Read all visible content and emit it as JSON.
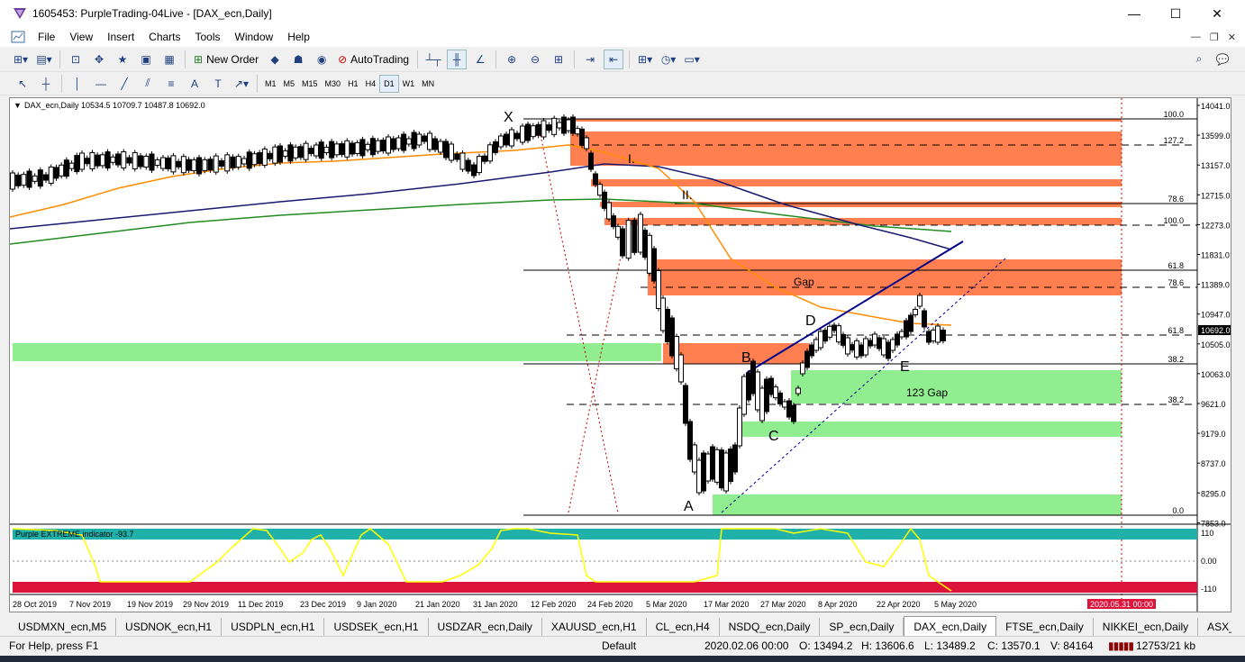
{
  "window": {
    "title": "1605453: PurpleTrading-04Live - [DAX_ecn,Daily]",
    "minimize": "—",
    "maximize": "☐",
    "close": "✕"
  },
  "menu": [
    "File",
    "View",
    "Insert",
    "Charts",
    "Tools",
    "Window",
    "Help"
  ],
  "toolbar": {
    "new_order": "New Order",
    "auto_trading": "AutoTrading"
  },
  "timeframes": [
    "M1",
    "M5",
    "M15",
    "M30",
    "H1",
    "H4",
    "D1",
    "W1",
    "MN"
  ],
  "active_timeframe": "D1",
  "chart": {
    "symbol_info": "DAX_ecn,Daily  10534.5 10709.7 10487.8 10692.0",
    "current_price": "10692.0",
    "price_axis": [
      "14041.0",
      "13599.0",
      "13157.0",
      "12715.0",
      "12273.0",
      "11831.0",
      "11389.0",
      "10947.0",
      "10505.0",
      "10063.0",
      "9621.0",
      "9179.0",
      "8737.0",
      "8295.0",
      "7853.0"
    ],
    "date_axis": [
      "28 Oct 2019",
      "7 Nov 2019",
      "19 Nov 2019",
      "29 Nov 2019",
      "11 Dec 2019",
      "23 Dec 2019",
      "9 Jan 2020",
      "21 Jan 2020",
      "31 Jan 2020",
      "12 Feb 2020",
      "24 Feb 2020",
      "5 Mar 2020",
      "17 Mar 2020",
      "27 Mar 2020",
      "8 Apr 2020",
      "22 Apr 2020",
      "5 May 2020"
    ],
    "date_marker": "2020.05.31 00:00",
    "pattern_labels": [
      "X",
      "A",
      "B",
      "C",
      "D",
      "E"
    ],
    "roman_labels": [
      "I.",
      "II."
    ],
    "zone_labels": [
      "Gap",
      "123 Gap"
    ],
    "fib_levels": [
      "100.0",
      "127.2",
      "78.6",
      "100.0",
      "61.8",
      "78.6",
      "61.8",
      "38.2",
      "38.2",
      "0.0"
    ],
    "indicator": {
      "name": "Purple EXTREME indicator -93.7",
      "axis": [
        "110",
        "0.00",
        "-110"
      ]
    },
    "colors": {
      "zone_orange": "#ff7f50",
      "zone_green": "#90ee90",
      "ma_orange": "#ff8c00",
      "ma_navy": "#191970",
      "ma_green": "#228b22",
      "ind_line": "#ffff00",
      "ind_top": "#20b2aa",
      "ind_bottom": "#dc143c"
    }
  },
  "tabs": [
    "USDMXN_ecn,M5",
    "USDNOK_ecn,H1",
    "USDPLN_ecn,H1",
    "USDSEK_ecn,H1",
    "USDZAR_ecn,Daily",
    "XAUUSD_ecn,H1",
    "CL_ecn,H4",
    "NSDQ_ecn,Daily",
    "SP_ecn,Daily",
    "DAX_ecn,Daily",
    "FTSE_ecn,Daily",
    "NIKKEI_ecn,Daily",
    "ASX_ecn,D"
  ],
  "active_tab": "DAX_ecn,Daily",
  "status": {
    "help": "For Help, press F1",
    "profile": "Default",
    "datetime": "2020.02.06 00:00",
    "open": "O: 13494.2",
    "high": "H: 13606.6",
    "low": "L: 13489.2",
    "close": "C: 13570.1",
    "volume": "V: 84164",
    "traffic": "12753/21 kb"
  }
}
